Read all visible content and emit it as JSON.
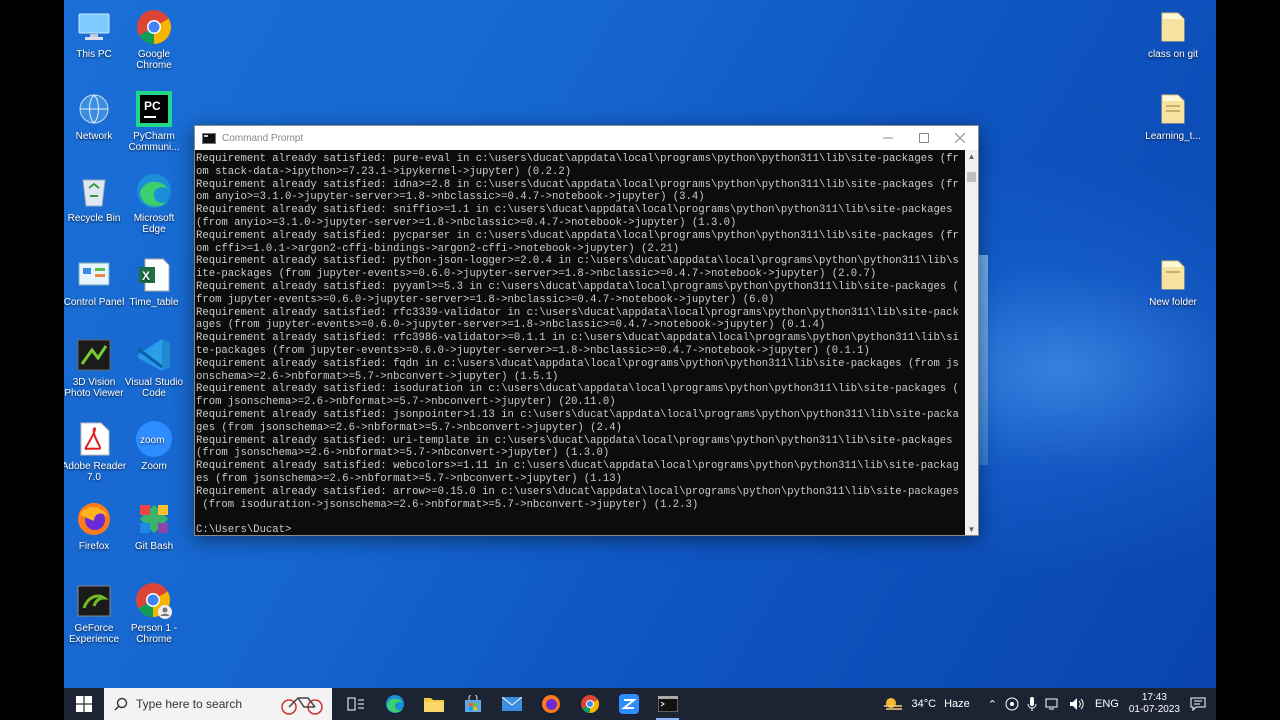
{
  "desktop": {
    "left_icons": [
      {
        "label": "This PC",
        "icon": "this-pc-icon"
      },
      {
        "label": "Google Chrome",
        "icon": "chrome-icon"
      },
      {
        "label": "Network",
        "icon": "network-icon"
      },
      {
        "label": "PyCharm Communi...",
        "icon": "pycharm-icon"
      },
      {
        "label": "Recycle Bin",
        "icon": "recycle-bin-icon"
      },
      {
        "label": "Microsoft Edge",
        "icon": "edge-icon"
      },
      {
        "label": "Control Panel",
        "icon": "control-panel-icon"
      },
      {
        "label": "Time_table",
        "icon": "excel-icon"
      },
      {
        "label": "3D Vision Photo Viewer",
        "icon": "3d-vision-icon"
      },
      {
        "label": "Visual Studio Code",
        "icon": "vscode-icon"
      },
      {
        "label": "Adobe Reader 7.0",
        "icon": "adobe-reader-icon"
      },
      {
        "label": "Zoom",
        "icon": "zoom-icon"
      },
      {
        "label": "Firefox",
        "icon": "firefox-icon"
      },
      {
        "label": "Git Bash",
        "icon": "git-bash-icon"
      },
      {
        "label": "GeForce Experience",
        "icon": "geforce-icon"
      },
      {
        "label": "Person 1 - Chrome",
        "icon": "chrome-person-icon"
      }
    ],
    "right_icons": [
      {
        "label": "class on git",
        "icon": "folder-icon"
      },
      {
        "label": "Learning_t...",
        "icon": "folder-icon"
      },
      {
        "label": "New folder",
        "icon": "folder-icon"
      }
    ]
  },
  "cmd": {
    "title": "Command Prompt",
    "lines": [
      "Requirement already satisfied: pure-eval in c:\\users\\ducat\\appdata\\local\\programs\\python\\python311\\lib\\site-packages (fr",
      "om stack-data->ipython>=7.23.1->ipykernel->jupyter) (0.2.2)",
      "Requirement already satisfied: idna>=2.8 in c:\\users\\ducat\\appdata\\local\\programs\\python\\python311\\lib\\site-packages (fr",
      "om anyio>=3.1.0->jupyter-server>=1.8->nbclassic>=0.4.7->notebook->jupyter) (3.4)",
      "Requirement already satisfied: sniffio>=1.1 in c:\\users\\ducat\\appdata\\local\\programs\\python\\python311\\lib\\site-packages",
      "(from anyio>=3.1.0->jupyter-server>=1.8->nbclassic>=0.4.7->notebook->jupyter) (1.3.0)",
      "Requirement already satisfied: pycparser in c:\\users\\ducat\\appdata\\local\\programs\\python\\python311\\lib\\site-packages (fr",
      "om cffi>=1.0.1->argon2-cffi-bindings->argon2-cffi->notebook->jupyter) (2.21)",
      "Requirement already satisfied: python-json-logger>=2.0.4 in c:\\users\\ducat\\appdata\\local\\programs\\python\\python311\\lib\\s",
      "ite-packages (from jupyter-events>=0.6.0->jupyter-server>=1.8->nbclassic>=0.4.7->notebook->jupyter) (2.0.7)",
      "Requirement already satisfied: pyyaml>=5.3 in c:\\users\\ducat\\appdata\\local\\programs\\python\\python311\\lib\\site-packages (",
      "from jupyter-events>=0.6.0->jupyter-server>=1.8->nbclassic>=0.4.7->notebook->jupyter) (6.0)",
      "Requirement already satisfied: rfc3339-validator in c:\\users\\ducat\\appdata\\local\\programs\\python\\python311\\lib\\site-pack",
      "ages (from jupyter-events>=0.6.0->jupyter-server>=1.8->nbclassic>=0.4.7->notebook->jupyter) (0.1.4)",
      "Requirement already satisfied: rfc3986-validator>=0.1.1 in c:\\users\\ducat\\appdata\\local\\programs\\python\\python311\\lib\\si",
      "te-packages (from jupyter-events>=0.6.0->jupyter-server>=1.8->nbclassic>=0.4.7->notebook->jupyter) (0.1.1)",
      "Requirement already satisfied: fqdn in c:\\users\\ducat\\appdata\\local\\programs\\python\\python311\\lib\\site-packages (from js",
      "onschema>=2.6->nbformat>=5.7->nbconvert->jupyter) (1.5.1)",
      "Requirement already satisfied: isoduration in c:\\users\\ducat\\appdata\\local\\programs\\python\\python311\\lib\\site-packages (",
      "from jsonschema>=2.6->nbformat>=5.7->nbconvert->jupyter) (20.11.0)",
      "Requirement already satisfied: jsonpointer>1.13 in c:\\users\\ducat\\appdata\\local\\programs\\python\\python311\\lib\\site-packa",
      "ges (from jsonschema>=2.6->nbformat>=5.7->nbconvert->jupyter) (2.4)",
      "Requirement already satisfied: uri-template in c:\\users\\ducat\\appdata\\local\\programs\\python\\python311\\lib\\site-packages",
      "(from jsonschema>=2.6->nbformat>=5.7->nbconvert->jupyter) (1.3.0)",
      "Requirement already satisfied: webcolors>=1.11 in c:\\users\\ducat\\appdata\\local\\programs\\python\\python311\\lib\\site-packag",
      "es (from jsonschema>=2.6->nbformat>=5.7->nbconvert->jupyter) (1.13)",
      "Requirement already satisfied: arrow>=0.15.0 in c:\\users\\ducat\\appdata\\local\\programs\\python\\python311\\lib\\site-packages",
      " (from isoduration->jsonschema>=2.6->nbformat>=5.7->nbconvert->jupyter) (1.2.3)",
      "",
      "C:\\Users\\Ducat>"
    ]
  },
  "taskbar": {
    "search_placeholder": "Type here to search",
    "weather_temp": "34°C",
    "weather_desc": "Haze",
    "language": "ENG",
    "time": "17:43",
    "date": "01-07-2023"
  }
}
